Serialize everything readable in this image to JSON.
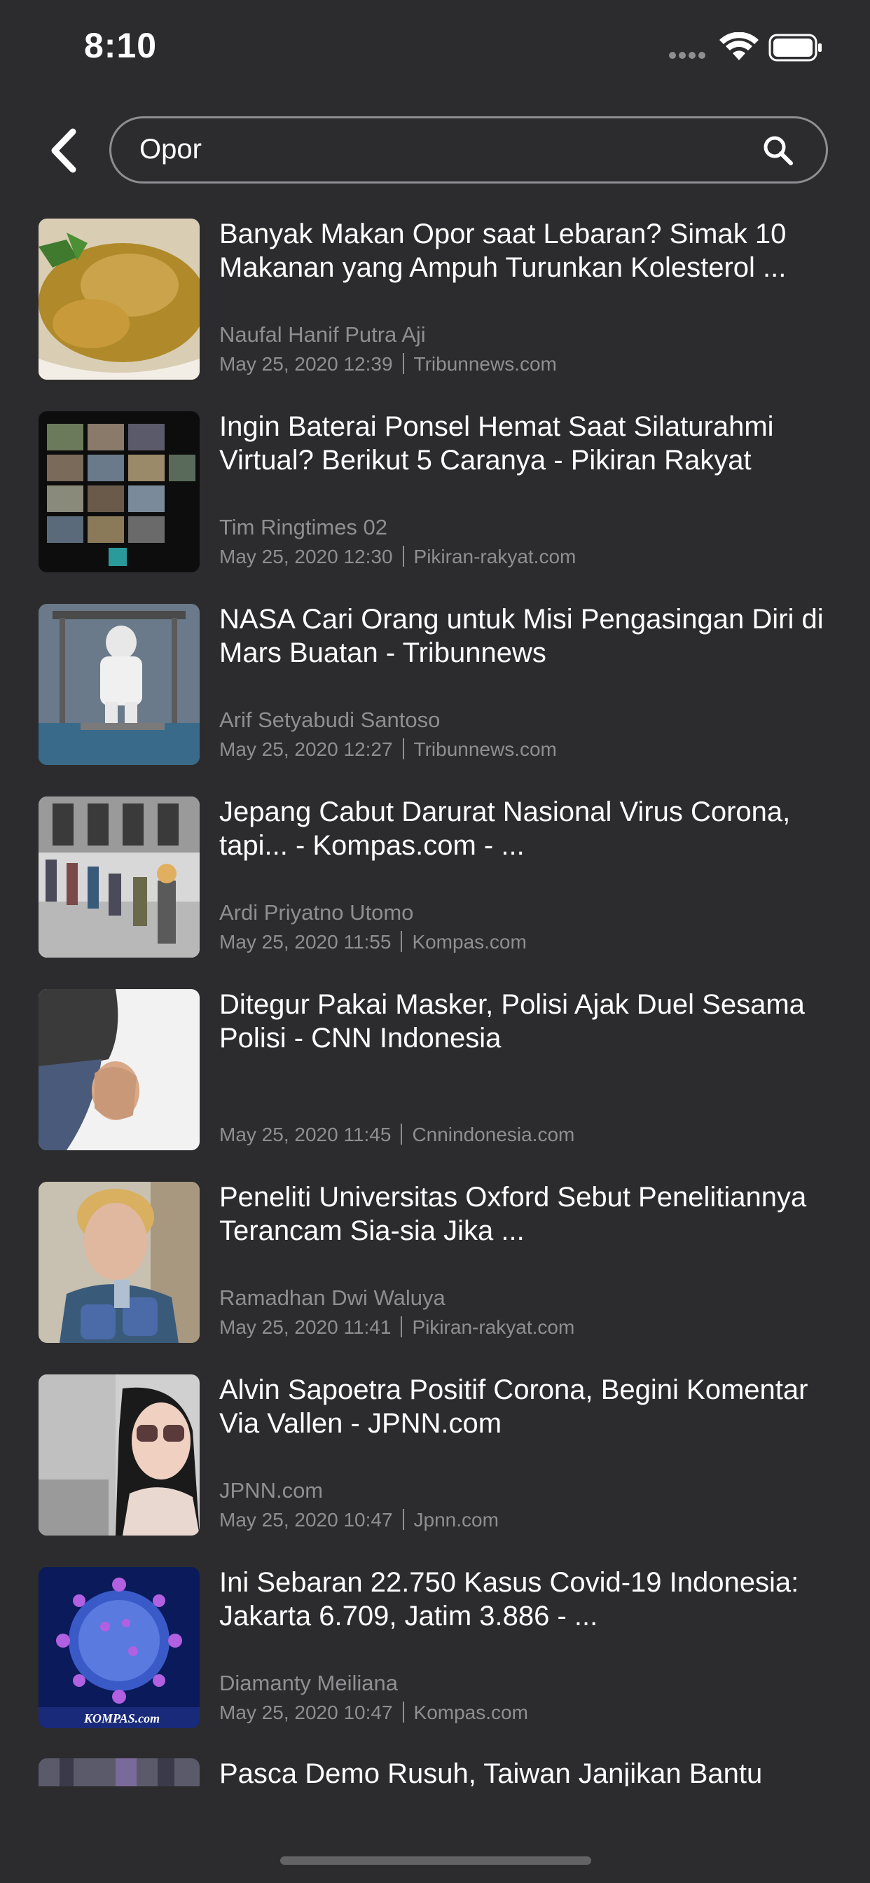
{
  "status_bar": {
    "time": "8:10"
  },
  "search": {
    "query": "Opor"
  },
  "articles": [
    {
      "title": "Banyak Makan Opor saat Lebaran? Simak 10 Makanan yang Ampuh Turunkan Kolesterol ...",
      "author": "Naufal Hanif Putra Aji",
      "date": "May 25, 2020 12:39",
      "source": "Tribunnews.com"
    },
    {
      "title": "Ingin Baterai Ponsel Hemat Saat Silaturahmi Virtual? Berikut 5 Caranya - Pikiran Rakyat",
      "author": "Tim Ringtimes 02",
      "date": "May 25, 2020 12:30",
      "source": "Pikiran-rakyat.com"
    },
    {
      "title": "NASA Cari Orang untuk Misi Pengasingan Diri di Mars Buatan - Tribunnews",
      "author": "Arif Setyabudi Santoso",
      "date": "May 25, 2020 12:27",
      "source": "Tribunnews.com"
    },
    {
      "title": "Jepang Cabut Darurat Nasional Virus Corona, tapi... - Kompas.com - ...",
      "author": "Ardi Priyatno Utomo",
      "date": "May 25, 2020 11:55",
      "source": "Kompas.com"
    },
    {
      "title": "Ditegur Pakai Masker, Polisi Ajak Duel Sesama Polisi - CNN Indonesia",
      "author": "",
      "date": "May 25, 2020 11:45",
      "source": "Cnnindonesia.com"
    },
    {
      "title": "Peneliti Universitas Oxford Sebut Penelitiannya Terancam Sia-sia Jika ...",
      "author": "Ramadhan Dwi Waluya",
      "date": "May 25, 2020 11:41",
      "source": "Pikiran-rakyat.com"
    },
    {
      "title": "Alvin Sapoetra Positif Corona, Begini Komentar Via Vallen - JPNN.com",
      "author": "JPNN.com",
      "date": "May 25, 2020 10:47",
      "source": "Jpnn.com"
    },
    {
      "title": "Ini Sebaran 22.750 Kasus Covid-19 Indonesia: Jakarta 6.709, Jatim 3.886 - ...",
      "author": "Diamanty Meiliana",
      "date": "May 25, 2020 10:47",
      "source": "Kompas.com"
    }
  ],
  "partial_article": {
    "title": "Pasca Demo Rusuh, Taiwan Janjikan Bantu"
  },
  "thumb_logo_text": "KOMPAS.com"
}
